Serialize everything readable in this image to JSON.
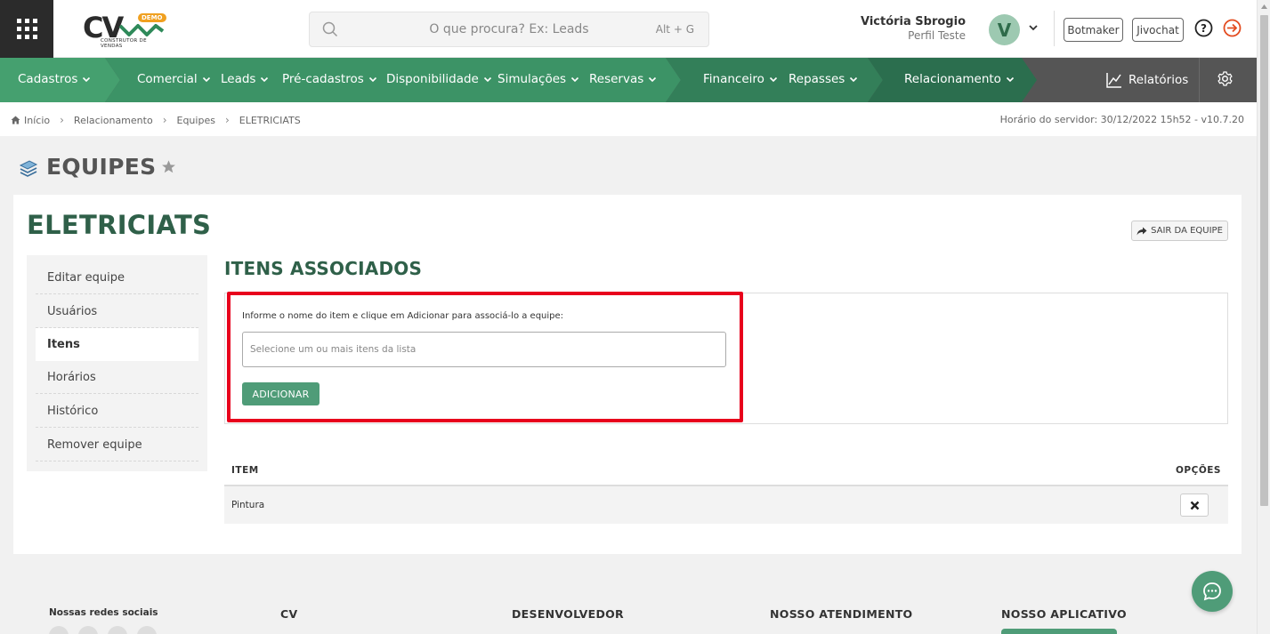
{
  "header": {
    "logo_text": "CV",
    "logo_badge": "DEMO",
    "logo_sub": "CONSTRUTOR DE VENDAS",
    "search_placeholder": "O que procura? Ex: Leads",
    "search_shortcut": "Alt + G",
    "user_name": "Victória Sbrogio",
    "user_role": "Perfil Teste",
    "avatar_initial": "V",
    "botmaker": "Botmaker",
    "jivochat": "Jivochat"
  },
  "nav": {
    "items": [
      {
        "label": "Cadastros"
      },
      {
        "label": "Comercial"
      },
      {
        "label": "Leads"
      },
      {
        "label": "Pré-cadastros"
      },
      {
        "label": "Disponibilidade"
      },
      {
        "label": "Simulações"
      },
      {
        "label": "Reservas"
      },
      {
        "label": "Financeiro"
      },
      {
        "label": "Repasses"
      },
      {
        "label": "Relacionamento"
      }
    ],
    "reports": "Relatórios",
    "colors": {
      "seg1": "#45a06f",
      "seg2": "#3c9366",
      "seg3": "#337f59",
      "seg4": "#2b6e4e",
      "rest": "#555555"
    }
  },
  "breadcrumb": {
    "items": [
      "Início",
      "Relacionamento",
      "Equipes",
      "ELETRICIATS"
    ],
    "server": "Horário do servidor: 30/12/2022 15h52 - v10.7.20"
  },
  "page": {
    "title": "EQUIPES",
    "team_name": "ELETRICIATS",
    "leave_button": "SAIR DA EQUIPE"
  },
  "side_menu": {
    "items": [
      {
        "label": "Editar equipe"
      },
      {
        "label": "Usuários"
      },
      {
        "label": "Itens"
      },
      {
        "label": "Horários"
      },
      {
        "label": "Histórico"
      },
      {
        "label": "Remover equipe"
      }
    ],
    "active": "Itens"
  },
  "assoc": {
    "title": "ITENS ASSOCIADOS",
    "instruction": "Informe o nome do item e clique em Adicionar para associá-lo a equipe:",
    "input_placeholder": "Selecione um ou mais itens da lista",
    "add_button": "ADICIONAR"
  },
  "table": {
    "headers": {
      "item": "ITEM",
      "options": "OPÇÕES"
    },
    "rows": [
      {
        "item": "Pintura"
      }
    ]
  },
  "footer": {
    "social": "Nossas redes sociais",
    "col_cv": "CV",
    "col_dev": "DESENVOLVEDOR",
    "col_support": "NOSSO ATENDIMENTO",
    "col_app": "NOSSO APLICATIVO"
  },
  "colors": {
    "brand_green": "#2f6049",
    "button_green": "#4f9c78",
    "highlight_red": "#e8001c"
  }
}
